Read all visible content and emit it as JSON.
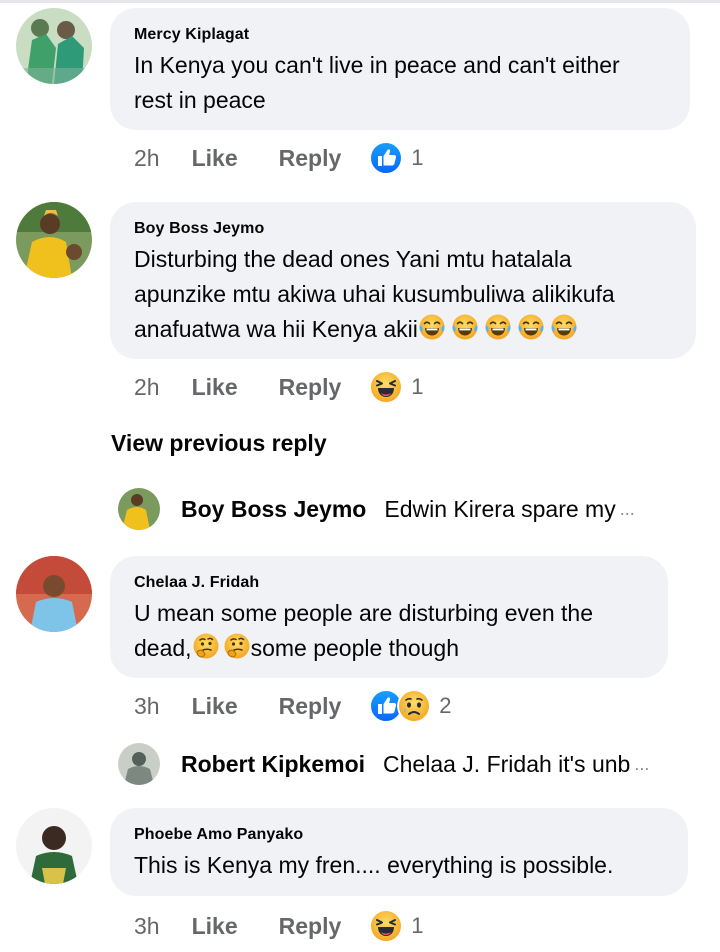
{
  "comments": [
    {
      "author": "Mercy Kiplagat",
      "lines": [
        "In Kenya you can't live in peace and can't either",
        "rest in peace"
      ],
      "time": "2h",
      "like_label": "Like",
      "reply_label": "Reply",
      "reactions": [
        "like-reaction-icon"
      ],
      "reaction_count": "1"
    },
    {
      "author": "Boy Boss Jeymo",
      "lines": [
        "Disturbing the dead ones Yani mtu hatalala",
        "apunzike mtu akiwa uhai kusumbuliwa alikikufa",
        "anafuatwa  wa hii Kenya akii"
      ],
      "trailing_emoji": [
        "tears-of-joy-emoji",
        "tears-of-joy-emoji",
        "tears-of-joy-emoji",
        "tears-of-joy-emoji",
        "tears-of-joy-emoji"
      ],
      "time": "2h",
      "like_label": "Like",
      "reply_label": "Reply",
      "reactions": [
        "haha-reaction-icon"
      ],
      "reaction_count": "1"
    },
    {
      "author": "Chelaa J. Fridah",
      "lines": [
        "U mean some people are disturbing even the",
        "some people though"
      ],
      "line2_prefix": "dead,",
      "inline_emoji": [
        "thinking-emoji",
        "thinking-emoji"
      ],
      "time": "3h",
      "like_label": "Like",
      "reply_label": "Reply",
      "reactions": [
        "like-reaction-icon",
        "sad-reaction-icon"
      ],
      "reaction_count": "2"
    },
    {
      "author": "Phoebe Amo Panyako",
      "lines": [
        "This is Kenya my fren.... everything is possible."
      ],
      "time": "3h",
      "like_label": "Like",
      "reply_label": "Reply",
      "reactions": [
        "haha-reaction-icon"
      ],
      "reaction_count": "1"
    }
  ],
  "view_previous_reply": "View previous reply",
  "replies": [
    {
      "author": "Boy Boss Jeymo",
      "preview": "Edwin Kirera spare my",
      "ellipsis": "..."
    },
    {
      "author": "Robert Kipkemoi",
      "preview": "Chelaa J. Fridah it's unb",
      "ellipsis": "..."
    }
  ],
  "colors": {
    "bubble_bg": "#f0f2f5",
    "meta_text": "#65676b",
    "like_blue": "#1877f2",
    "haha_yellow": "#f7b125"
  }
}
